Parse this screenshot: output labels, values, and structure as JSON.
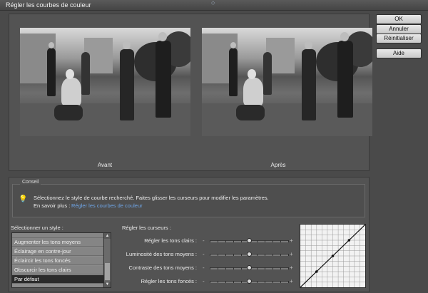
{
  "window": {
    "title": "Régler les courbes de couleur"
  },
  "preview": {
    "before_label": "Avant",
    "after_label": "Après"
  },
  "tips": {
    "legend": "Conseil",
    "icon": "lightbulb-icon",
    "text": "Sélectionnez le style de courbe recherché. Faites glisser les curseurs pour modifier les paramètres.",
    "more_label": "En savoir plus :",
    "more_link": "Régler les courbes de couleur"
  },
  "styles": {
    "label": "Sélectionner un style :",
    "items": [
      {
        "label": "Augmenter les tons moyens",
        "selected": false
      },
      {
        "label": "Éclairage en contre-jour",
        "selected": false
      },
      {
        "label": "Éclaircir les tons foncés",
        "selected": false
      },
      {
        "label": "Obscurcir les tons clairs",
        "selected": false
      },
      {
        "label": "Par défaut",
        "selected": true
      }
    ]
  },
  "sliders": {
    "label": "Régler les curseurs :",
    "items": [
      {
        "label": "Régler les tons clairs :",
        "value": 0.5
      },
      {
        "label": "Luminosité des tons moyens :",
        "value": 0.5
      },
      {
        "label": "Contraste des tons moyens :",
        "value": 0.5
      },
      {
        "label": "Régler les tons foncés :",
        "value": 0.5
      }
    ],
    "minus": "-",
    "plus": "+"
  },
  "buttons": {
    "ok": "OK",
    "cancel": "Annuler",
    "reset": "Réinitialiser",
    "help": "Aide"
  },
  "colors": {
    "accent_link": "#6fa6e8",
    "background": "#4a4a4a",
    "panel": "#535353"
  }
}
